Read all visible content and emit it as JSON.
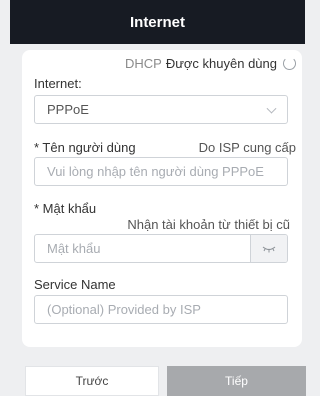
{
  "header": {
    "title": "Internet"
  },
  "internet": {
    "dhcp_label": "DHCP",
    "recommended_label": "Được khuyên dùng",
    "label": "Internet:",
    "selected": "PPPoE"
  },
  "username": {
    "label": "* Tên người dùng",
    "hint": "Do ISP cung cấp",
    "placeholder": "Vui lòng nhập tên người dùng PPPoE"
  },
  "password": {
    "label": "* Mật khẩu",
    "hint": "Nhận tài khoản từ thiết bị cũ",
    "placeholder": "Mật khẩu"
  },
  "service": {
    "label": "Service Name",
    "placeholder": "(Optional) Provided by ISP"
  },
  "buttons": {
    "prev": "Trước",
    "next": "Tiếp"
  },
  "icons": {
    "refresh": "refresh-icon",
    "chevron": "chevron-down-icon",
    "eye": "eye-closed-icon"
  }
}
